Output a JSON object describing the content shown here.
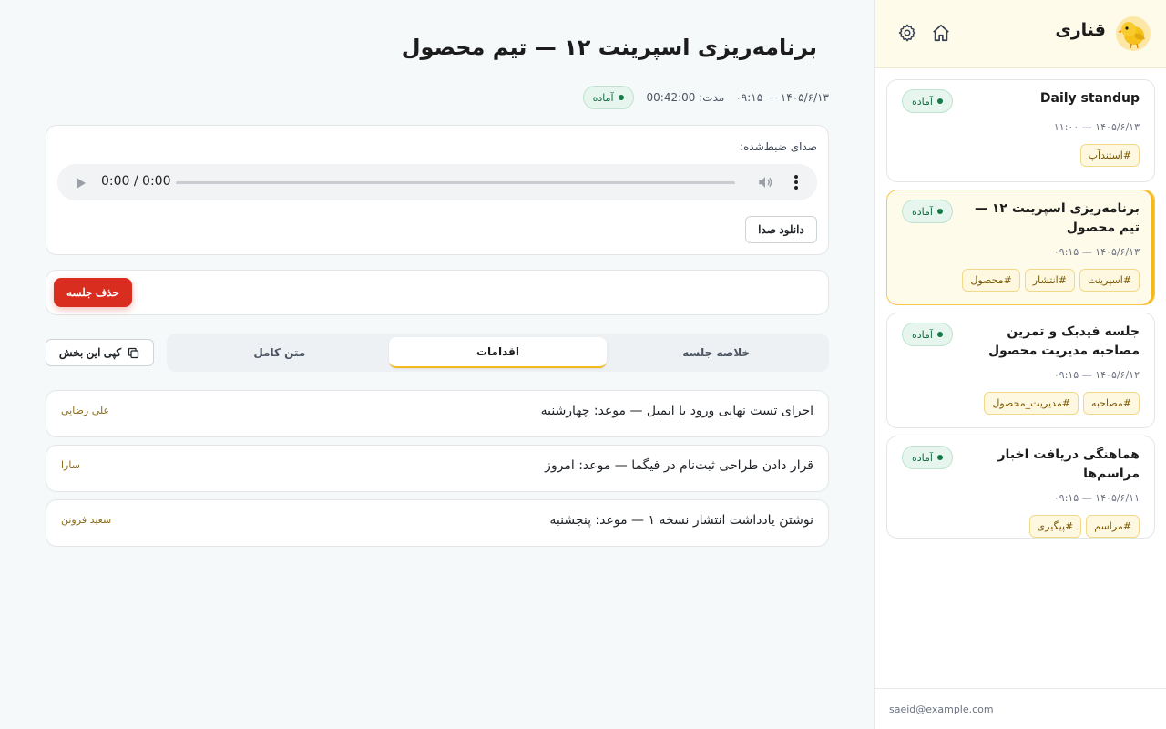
{
  "sidebar": {
    "app_title": "قناری",
    "meetings": [
      {
        "title": "Daily standup",
        "status": "آماده",
        "date": "۱۴۰۵/۶/۱۳ — ۱۱:۰۰",
        "tags": [
          "#استندآپ"
        ],
        "active": false
      },
      {
        "title": "برنامه‌ریزی اسپرینت ۱۲ — تیم محصول",
        "status": "آماده",
        "date": "۱۴۰۵/۶/۱۳ — ۰۹:۱۵",
        "tags": [
          "#اسپرینت",
          "#انتشار",
          "#محصول"
        ],
        "active": true
      },
      {
        "title": "جلسه فیدبک و تمرین مصاحبه مدیریت محصول",
        "status": "آماده",
        "date": "۱۴۰۵/۶/۱۲ — ۰۹:۱۵",
        "tags": [
          "#مصاحبه",
          "#مدیریت_محصول"
        ],
        "active": false
      },
      {
        "title": "هماهنگی دریافت اخبار مراسم‌ها",
        "status": "آماده",
        "date": "۱۴۰۵/۶/۱۱ — ۰۹:۱۵",
        "tags": [
          "#مراسم",
          "#پیگیری"
        ],
        "active": false
      }
    ],
    "footer_email": "saeid@example.com"
  },
  "main": {
    "title": "برنامه‌ریزی اسپرینت ۱۲ — تیم محصول",
    "meta": {
      "datetime": "۱۴۰۵/۶/۱۳ — ۰۹:۱۵",
      "duration": "مدت: 00:42:00",
      "status": "آماده"
    },
    "audio": {
      "label": "صدای ضبط‌شده:",
      "time": "0:00 / 0:00",
      "download_label": "دانلود صدا"
    },
    "delete_label": "حذف جلسه",
    "tabs": [
      {
        "label": "خلاصه جلسه",
        "active": false
      },
      {
        "label": "اقدامات",
        "active": true
      },
      {
        "label": "متن کامل",
        "active": false
      }
    ],
    "copy_label": "کپی این بخش",
    "actions": [
      {
        "text": "اجرای تست نهایی ورود با ایمیل — موعد: چهارشنبه",
        "owner": "علی رضایی"
      },
      {
        "text": "قرار دادن طراحی ثبت‌نام در فیگما — موعد: امروز",
        "owner": "سارا"
      },
      {
        "text": "نوشتن یادداشت انتشار نسخه ۱ — موعد: پنجشنبه",
        "owner": "سعید فروتن"
      }
    ]
  },
  "colors": {
    "accent": "#f4b91f",
    "status_green": "#137a48",
    "danger": "#d92d20"
  },
  "icons": {
    "logo": "canary-bird-logo",
    "home": "home-icon",
    "settings": "gear-icon",
    "copy": "copy-icon",
    "play": "play-icon",
    "volume": "volume-icon",
    "more": "more-vertical-icon"
  }
}
